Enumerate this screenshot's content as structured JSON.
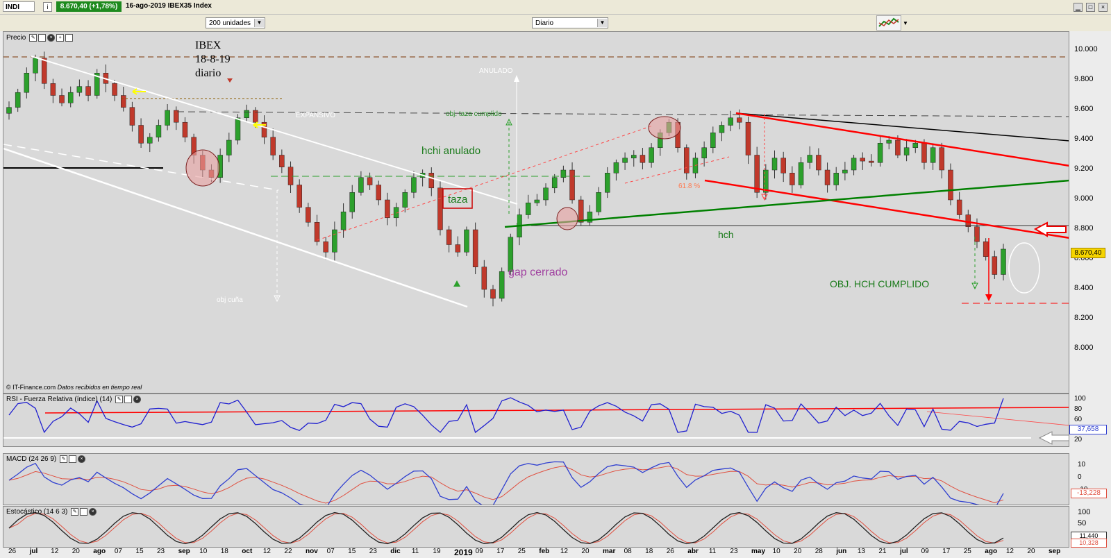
{
  "header": {
    "symbol": "INDI",
    "price_change": "8.670,40 (+1,78%)",
    "title": "16-ago-2019 IBEX35 Index",
    "info": "i"
  },
  "toolbar": {
    "units": "200 unidades",
    "period": "Diario"
  },
  "price_panel": {
    "label": "Precio",
    "credit": "© IT-Finance.com",
    "credit_note": "Datos recibidos en tiempo real",
    "current_value": "8.670,40"
  },
  "annotations": {
    "ibex_1": "IBEX",
    "ibex_2": "18-8-19",
    "ibex_3": "diario",
    "anulado": "ANULADO",
    "expansivo": "EXPANSIVO",
    "taza_cumplido": "obj. taza cumplido",
    "hchi": "hchi anulado",
    "taza": "taza",
    "gap": "gap cerrado",
    "obj_cuna": "obj cuña",
    "fib": "61.8 %",
    "hch": "hch",
    "obj_hch": "OBJ. HCH CUMPLIDO"
  },
  "rsi_panel": {
    "label": "RSI - Fuerza Relativa (índice) (14)",
    "value": "37,658",
    "ticks": [
      "100",
      "80",
      "60",
      "40",
      "20"
    ]
  },
  "macd_panel": {
    "label": "MACD (24 26 9)",
    "value": "-13,228",
    "ticks": [
      "10",
      "0",
      "-10"
    ]
  },
  "stoch_panel": {
    "label": "Estocástico (14 6 3)",
    "value_a": "11,440",
    "value_b": "10,328",
    "ticks": [
      "100",
      "50"
    ]
  },
  "colors": {
    "bg": "#d9d9d9",
    "up": "#2ca02c",
    "down": "#c0392b",
    "red_line": "#ff0000",
    "green_line": "#008000",
    "rsi": "#2020d0"
  },
  "chart_data": {
    "type": "candlestick",
    "title": "16-ago-2019 IBEX35 Index",
    "ylim": [
      7800,
      10150
    ],
    "y_ticks": [
      10000,
      9800,
      9600,
      9400,
      9200,
      9000,
      8800,
      8600,
      8400,
      8200,
      8000
    ],
    "y_tick_labels": [
      "10.000",
      "9.800",
      "9.600",
      "9.400",
      "9.200",
      "9.000",
      "8.800",
      "8.600",
      "8.400",
      "8.200",
      "8.000"
    ],
    "x_tick_labels": [
      "26",
      "jul",
      "12",
      "20",
      "ago",
      "07",
      "15",
      "23",
      "sep",
      "10",
      "18",
      "oct",
      "12",
      "22",
      "nov",
      "07",
      "15",
      "23",
      "dic",
      "11",
      "19",
      "2019",
      "09",
      "17",
      "25",
      "feb",
      "12",
      "20",
      "mar",
      "08",
      "18",
      "26",
      "abr",
      "11",
      "23",
      "may",
      "10",
      "20",
      "28",
      "jun",
      "13",
      "21",
      "jul",
      "09",
      "17",
      "25",
      "ago",
      "12",
      "20",
      "sep"
    ],
    "series": [
      {
        "values": [
          9620,
          9720,
          9850,
          9950,
          9780,
          9700,
          9650,
          9720,
          9760,
          9700,
          9850,
          9780,
          9700,
          9620,
          9500,
          9380,
          9420,
          9500,
          9600,
          9520,
          9420,
          9300,
          9200,
          9150,
          9300,
          9400,
          9550,
          9600,
          9520,
          9420,
          9300,
          9220,
          9100,
          8950,
          8850,
          8720,
          8650,
          8800,
          8920,
          9050,
          9150,
          9100,
          9000,
          8880,
          8950,
          9050,
          9150,
          9180,
          9080,
          8800,
          8700,
          8650,
          8800,
          8550,
          8400,
          8340,
          8520,
          8750,
          8900,
          8980,
          9000,
          9080,
          9150,
          9200,
          9000,
          8850,
          8920,
          9050,
          9180,
          9250,
          9280,
          9300,
          9250,
          9350,
          9450,
          9520,
          9350,
          9180,
          9280,
          9350,
          9450,
          9500,
          9550,
          9520,
          9300,
          9050,
          9200,
          9280,
          9180,
          9100,
          9250,
          9300,
          9200,
          9100,
          9180,
          9200,
          9280,
          9260,
          9250,
          9380,
          9400,
          9300,
          9350,
          9380,
          9250,
          9350,
          9200,
          9000,
          8900,
          8820,
          8720,
          8620,
          8500,
          8670
        ]
      }
    ]
  }
}
